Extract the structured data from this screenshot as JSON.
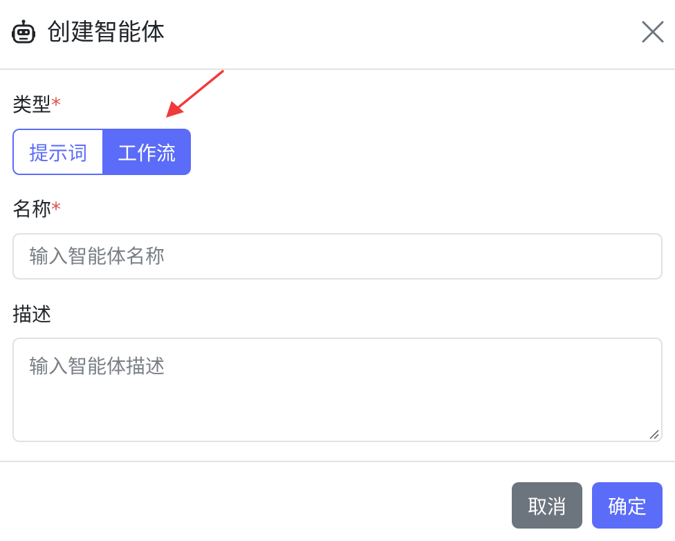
{
  "dialog": {
    "title": "创建智能体",
    "icon": "robot-icon",
    "close_icon": "close-icon"
  },
  "form": {
    "type": {
      "label": "类型",
      "required_mark": "*",
      "options": [
        "提示词",
        "工作流"
      ],
      "selected": "工作流"
    },
    "name": {
      "label": "名称",
      "required_mark": "*",
      "value": "",
      "placeholder": "输入智能体名称"
    },
    "description": {
      "label": "描述",
      "value": "",
      "placeholder": "输入智能体描述"
    }
  },
  "footer": {
    "cancel_label": "取消",
    "confirm_label": "确定"
  },
  "colors": {
    "primary": "#5b6cf8",
    "secondary": "#6c757d",
    "required": "#d9534f",
    "annotation_arrow": "#f23a3a"
  }
}
